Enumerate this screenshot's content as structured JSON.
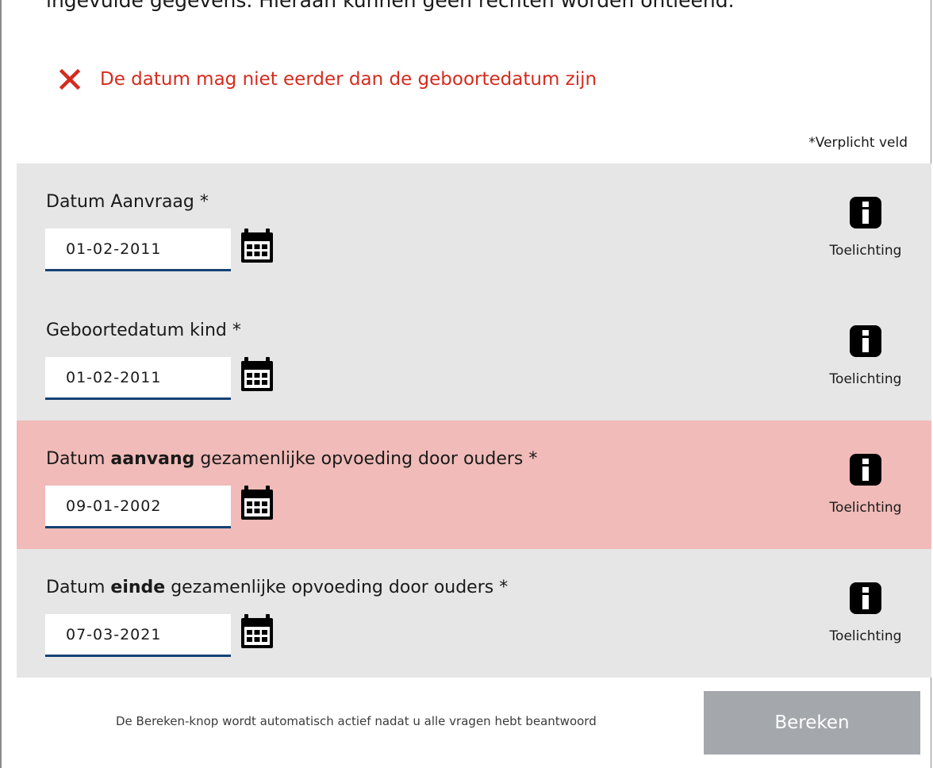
{
  "intro": {
    "cut_text": "ingevulde gegevens. Hieraan kunnen geen rechten worden ontleend."
  },
  "error": {
    "icon": "close-icon",
    "message": "De datum mag niet eerder dan de geboortedatum zijn",
    "color": "#d52b1e"
  },
  "required_note": "*Verplicht veld",
  "fields": [
    {
      "label_prefix": "Datum Aanvraag *",
      "label_bold": "",
      "label_suffix": "",
      "value": "01-02-2011",
      "info_label": "Toelichting",
      "has_error": false
    },
    {
      "label_prefix": "Geboortedatum kind *",
      "label_bold": "",
      "label_suffix": "",
      "value": "01-02-2011",
      "info_label": "Toelichting",
      "has_error": false
    },
    {
      "label_prefix": "Datum ",
      "label_bold": "aanvang",
      "label_suffix": " gezamenlijke opvoeding door ouders *",
      "value": "09-01-2002",
      "info_label": "Toelichting",
      "has_error": true
    },
    {
      "label_prefix": "Datum ",
      "label_bold": "einde",
      "label_suffix": " gezamenlijke opvoeding door ouders *",
      "value": "07-03-2021",
      "info_label": "Toelichting",
      "has_error": false
    }
  ],
  "footer": {
    "note": "De Bereken-knop wordt automatisch actief nadat u alle vragen hebt beantwoord",
    "button_label": "Bereken",
    "button_enabled": false
  },
  "colors": {
    "row_background": "#e6e6e6",
    "error_row_background": "#f0bbb8",
    "input_underline": "#154273",
    "button_disabled": "#a4a8ad"
  }
}
